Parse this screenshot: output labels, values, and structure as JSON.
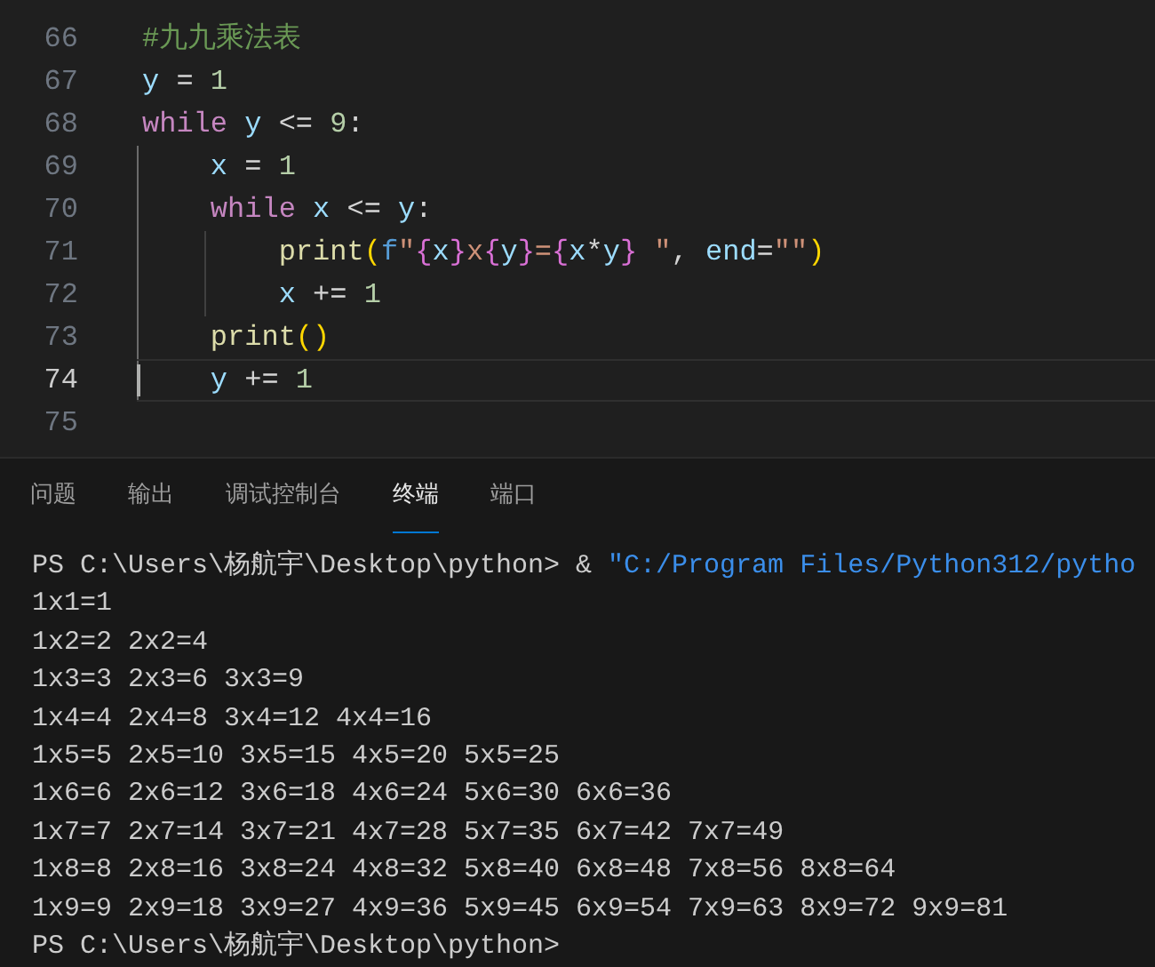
{
  "editor": {
    "lines": [
      {
        "number": "66",
        "current": false,
        "tokens": [
          {
            "kind": "comment",
            "text": "#九九乘法表"
          }
        ]
      },
      {
        "number": "67",
        "current": false,
        "tokens": [
          {
            "kind": "variable",
            "text": "y"
          },
          {
            "kind": "operator",
            "text": " = "
          },
          {
            "kind": "number",
            "text": "1"
          }
        ]
      },
      {
        "number": "68",
        "current": false,
        "tokens": [
          {
            "kind": "keyword",
            "text": "while"
          },
          {
            "kind": "variable",
            "text": " y"
          },
          {
            "kind": "operator",
            "text": " <= "
          },
          {
            "kind": "number",
            "text": "9"
          },
          {
            "kind": "operator",
            "text": ":"
          }
        ]
      },
      {
        "number": "69",
        "current": false,
        "tokens": [
          {
            "kind": "variable",
            "text": "    x"
          },
          {
            "kind": "operator",
            "text": " = "
          },
          {
            "kind": "number",
            "text": "1"
          }
        ]
      },
      {
        "number": "70",
        "current": false,
        "tokens": [
          {
            "kind": "keyword",
            "text": "    while"
          },
          {
            "kind": "variable",
            "text": " x"
          },
          {
            "kind": "operator",
            "text": " <= "
          },
          {
            "kind": "variable",
            "text": "y"
          },
          {
            "kind": "operator",
            "text": ":"
          }
        ]
      },
      {
        "number": "71",
        "current": false,
        "tokens": [
          {
            "kind": "function",
            "text": "        print"
          },
          {
            "kind": "bracket",
            "text": "("
          },
          {
            "kind": "prefix",
            "text": "f"
          },
          {
            "kind": "string",
            "text": "\""
          },
          {
            "kind": "brace",
            "text": "{"
          },
          {
            "kind": "variable",
            "text": "x"
          },
          {
            "kind": "brace",
            "text": "}"
          },
          {
            "kind": "string",
            "text": "x"
          },
          {
            "kind": "brace",
            "text": "{"
          },
          {
            "kind": "variable",
            "text": "y"
          },
          {
            "kind": "brace",
            "text": "}"
          },
          {
            "kind": "string",
            "text": "="
          },
          {
            "kind": "brace",
            "text": "{"
          },
          {
            "kind": "variable",
            "text": "x"
          },
          {
            "kind": "operator",
            "text": "*"
          },
          {
            "kind": "variable",
            "text": "y"
          },
          {
            "kind": "brace",
            "text": "}"
          },
          {
            "kind": "string",
            "text": " \""
          },
          {
            "kind": "operator",
            "text": ", "
          },
          {
            "kind": "variable",
            "text": "end"
          },
          {
            "kind": "operator",
            "text": "="
          },
          {
            "kind": "string",
            "text": "\"\""
          },
          {
            "kind": "bracket",
            "text": ")"
          }
        ]
      },
      {
        "number": "72",
        "current": false,
        "tokens": [
          {
            "kind": "variable",
            "text": "        x"
          },
          {
            "kind": "operator",
            "text": " += "
          },
          {
            "kind": "number",
            "text": "1"
          }
        ]
      },
      {
        "number": "73",
        "current": false,
        "tokens": [
          {
            "kind": "function",
            "text": "    print"
          },
          {
            "kind": "bracket",
            "text": "()"
          }
        ]
      },
      {
        "number": "74",
        "current": true,
        "tokens": [
          {
            "kind": "variable",
            "text": "    y"
          },
          {
            "kind": "operator",
            "text": " += "
          },
          {
            "kind": "number",
            "text": "1"
          }
        ]
      },
      {
        "number": "75",
        "current": false
      }
    ]
  },
  "panel": {
    "tabs": [
      {
        "label": "问题",
        "selected": false
      },
      {
        "label": "输出",
        "selected": false
      },
      {
        "label": "调试控制台",
        "selected": false
      },
      {
        "label": "终端",
        "selected": true
      },
      {
        "label": "端口",
        "selected": false
      }
    ]
  },
  "terminal": {
    "lines": [
      {
        "segments": [
          {
            "kind": "plain",
            "text": "PS C:\\Users\\杨航宇\\Desktop\\python> & "
          },
          {
            "kind": "string",
            "text": "\"C:/Program Files/Python312/pytho"
          }
        ]
      },
      {
        "segments": [
          {
            "kind": "plain",
            "text": "1x1=1"
          }
        ]
      },
      {
        "segments": [
          {
            "kind": "plain",
            "text": "1x2=2 2x2=4"
          }
        ]
      },
      {
        "segments": [
          {
            "kind": "plain",
            "text": "1x3=3 2x3=6 3x3=9"
          }
        ]
      },
      {
        "segments": [
          {
            "kind": "plain",
            "text": "1x4=4 2x4=8 3x4=12 4x4=16"
          }
        ]
      },
      {
        "segments": [
          {
            "kind": "plain",
            "text": "1x5=5 2x5=10 3x5=15 4x5=20 5x5=25"
          }
        ]
      },
      {
        "segments": [
          {
            "kind": "plain",
            "text": "1x6=6 2x6=12 3x6=18 4x6=24 5x6=30 6x6=36"
          }
        ]
      },
      {
        "segments": [
          {
            "kind": "plain",
            "text": "1x7=7 2x7=14 3x7=21 4x7=28 5x7=35 6x7=42 7x7=49"
          }
        ]
      },
      {
        "segments": [
          {
            "kind": "plain",
            "text": "1x8=8 2x8=16 3x8=24 4x8=32 5x8=40 6x8=48 7x8=56 8x8=64"
          }
        ]
      },
      {
        "segments": [
          {
            "kind": "plain",
            "text": "1x9=9 2x9=18 3x9=27 4x9=36 5x9=45 6x9=54 7x9=63 8x9=72 9x9=81"
          }
        ]
      },
      {
        "segments": [
          {
            "kind": "plain",
            "text": "PS C:\\Users\\杨航宇\\Desktop\\python>"
          }
        ]
      }
    ]
  }
}
